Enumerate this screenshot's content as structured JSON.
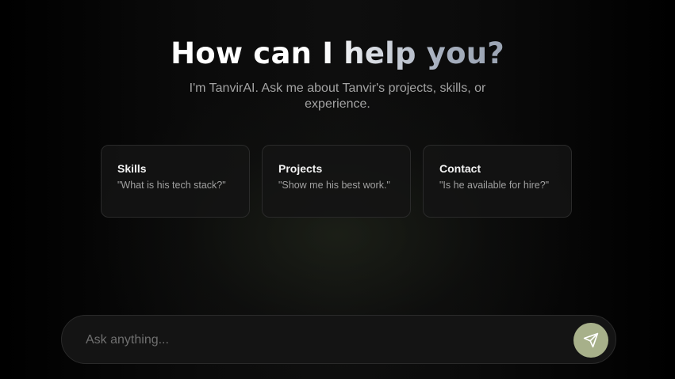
{
  "hero": {
    "title": "How can I help you?",
    "subtitle": "I'm TanvirAI. Ask me about Tanvir's projects, skills, or experience."
  },
  "suggestions": [
    {
      "title": "Skills",
      "prompt": "\"What is his tech stack?\""
    },
    {
      "title": "Projects",
      "prompt": "\"Show me his best work.\""
    },
    {
      "title": "Contact",
      "prompt": "\"Is he available for hire?\""
    }
  ],
  "chat_input": {
    "value": "",
    "placeholder": "Ask anything..."
  },
  "send_button": {
    "icon": "send-icon"
  },
  "colors": {
    "background": "#050505",
    "accent": "#a7b08a",
    "card_border": "#2a2a2a",
    "muted_text": "#a3a3a3"
  }
}
